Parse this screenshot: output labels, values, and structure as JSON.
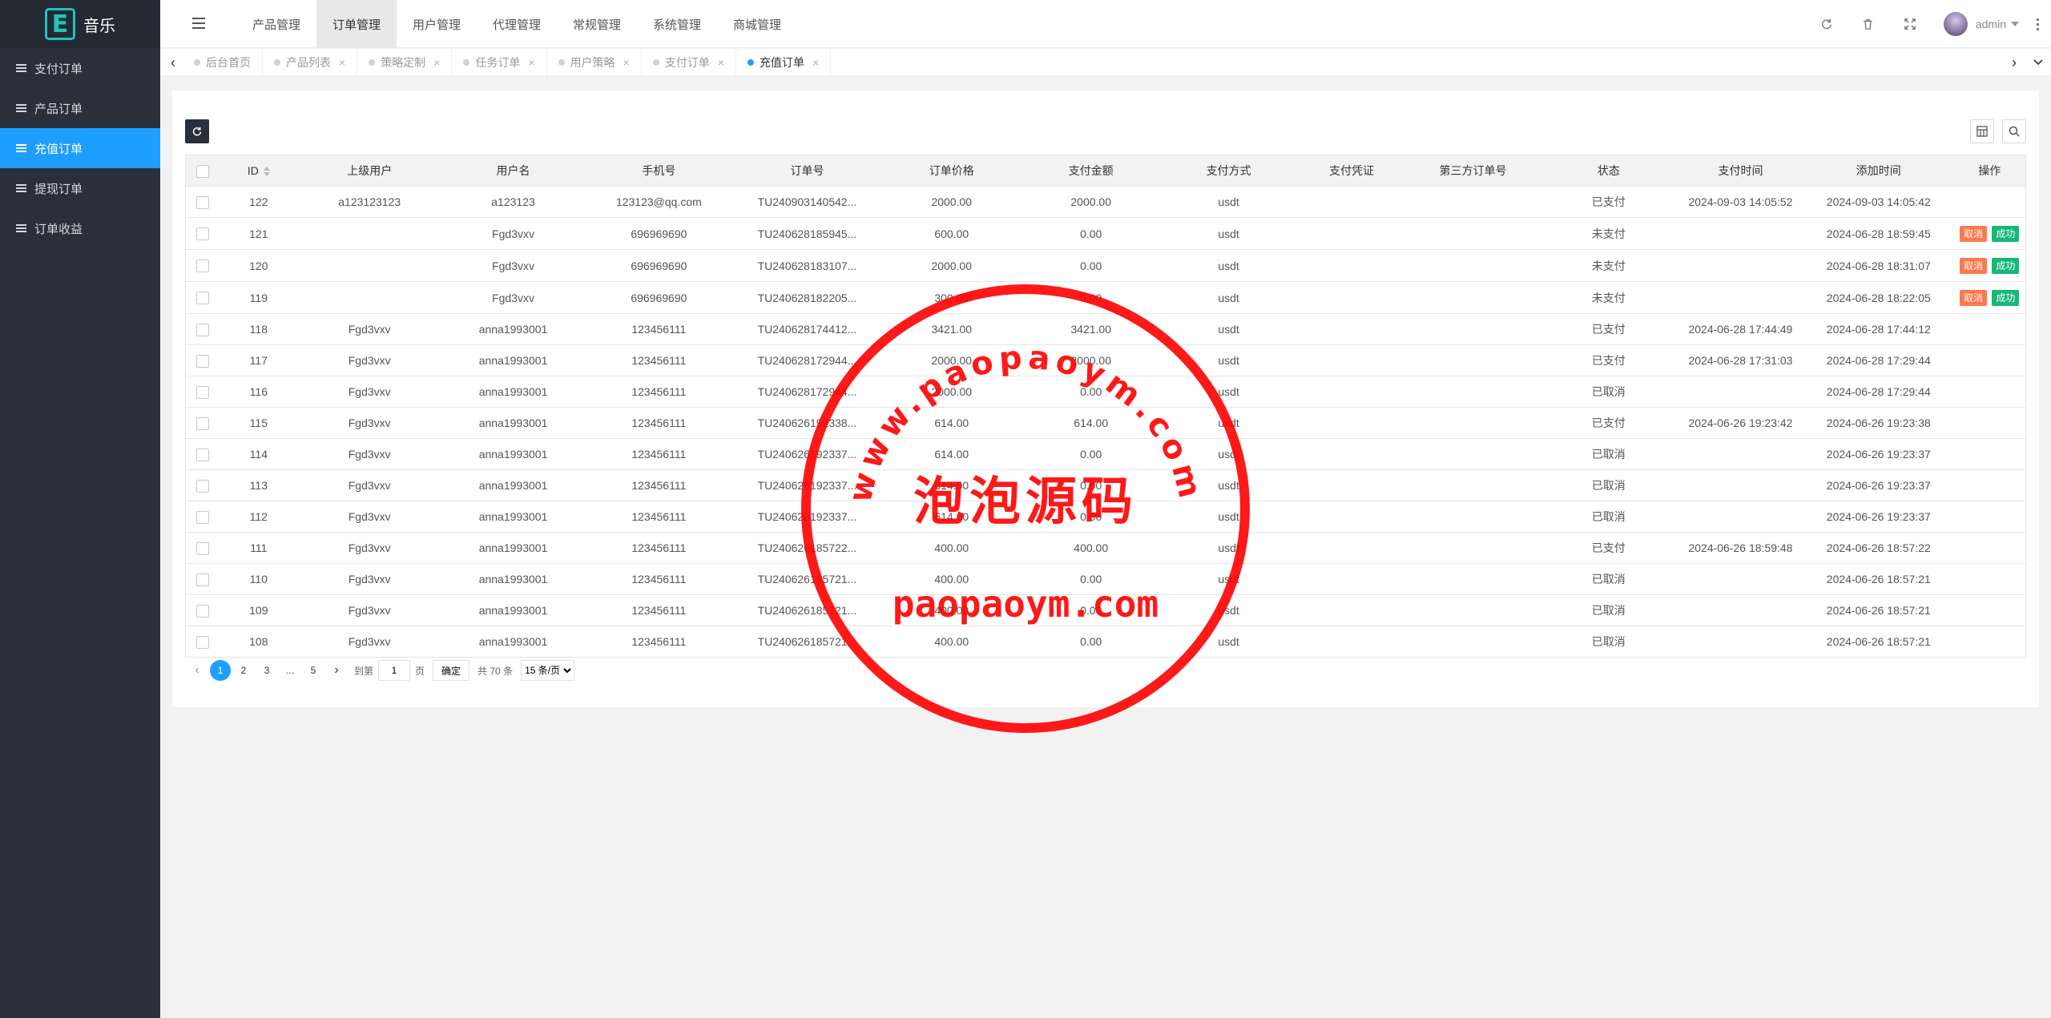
{
  "app": {
    "logo_letter": "E",
    "name": "音乐"
  },
  "sidebar": {
    "items": [
      {
        "label": "支付订单",
        "active": false
      },
      {
        "label": "产品订单",
        "active": false
      },
      {
        "label": "充值订单",
        "active": true
      },
      {
        "label": "提现订单",
        "active": false
      },
      {
        "label": "订单收益",
        "active": false
      }
    ]
  },
  "topnav": {
    "items": [
      {
        "label": "产品管理",
        "active": false
      },
      {
        "label": "订单管理",
        "active": true
      },
      {
        "label": "用户管理",
        "active": false
      },
      {
        "label": "代理管理",
        "active": false
      },
      {
        "label": "常规管理",
        "active": false
      },
      {
        "label": "系统管理",
        "active": false
      },
      {
        "label": "商城管理",
        "active": false
      }
    ]
  },
  "header": {
    "user_name": "admin"
  },
  "tabs": [
    {
      "label": "后台首页",
      "closable": false,
      "active": false
    },
    {
      "label": "产品列表",
      "closable": true,
      "active": false
    },
    {
      "label": "策略定制",
      "closable": true,
      "active": false
    },
    {
      "label": "任务订单",
      "closable": true,
      "active": false
    },
    {
      "label": "用户策略",
      "closable": true,
      "active": false
    },
    {
      "label": "支付订单",
      "closable": true,
      "active": false
    },
    {
      "label": "充值订单",
      "closable": true,
      "active": true
    }
  ],
  "table": {
    "columns": [
      "ID",
      "上级用户",
      "用户名",
      "手机号",
      "订单号",
      "订单价格",
      "支付金额",
      "支付方式",
      "支付凭证",
      "第三方订单号",
      "状态",
      "支付时间",
      "添加时间",
      "操作"
    ],
    "action_labels": {
      "cancel": "取消",
      "success": "成功"
    },
    "rows": [
      {
        "id": "122",
        "parent": "a123123123",
        "username": "a123123",
        "phone": "123123@qq.com",
        "order_no": "TU240903140542...",
        "price": "2000.00",
        "paid": "2000.00",
        "method": "usdt",
        "voucher": "",
        "third_no": "",
        "status": "已支付",
        "pay_time": "2024-09-03 14:05:52",
        "add_time": "2024-09-03 14:05:42",
        "actions": false
      },
      {
        "id": "121",
        "parent": "",
        "username": "Fgd3vxv",
        "phone": "696969690",
        "order_no": "TU240628185945...",
        "price": "600.00",
        "paid": "0.00",
        "method": "usdt",
        "voucher": "",
        "third_no": "",
        "status": "未支付",
        "pay_time": "",
        "add_time": "2024-06-28 18:59:45",
        "actions": true
      },
      {
        "id": "120",
        "parent": "",
        "username": "Fgd3vxv",
        "phone": "696969690",
        "order_no": "TU240628183107...",
        "price": "2000.00",
        "paid": "0.00",
        "method": "usdt",
        "voucher": "",
        "third_no": "",
        "status": "未支付",
        "pay_time": "",
        "add_time": "2024-06-28 18:31:07",
        "actions": true
      },
      {
        "id": "119",
        "parent": "",
        "username": "Fgd3vxv",
        "phone": "696969690",
        "order_no": "TU240628182205...",
        "price": "300.00",
        "paid": "0.00",
        "method": "usdt",
        "voucher": "",
        "third_no": "",
        "status": "未支付",
        "pay_time": "",
        "add_time": "2024-06-28 18:22:05",
        "actions": true
      },
      {
        "id": "118",
        "parent": "Fgd3vxv",
        "username": "anna1993001",
        "phone": "123456111",
        "order_no": "TU240628174412...",
        "price": "3421.00",
        "paid": "3421.00",
        "method": "usdt",
        "voucher": "",
        "third_no": "",
        "status": "已支付",
        "pay_time": "2024-06-28 17:44:49",
        "add_time": "2024-06-28 17:44:12",
        "actions": false
      },
      {
        "id": "117",
        "parent": "Fgd3vxv",
        "username": "anna1993001",
        "phone": "123456111",
        "order_no": "TU240628172944...",
        "price": "2000.00",
        "paid": "2000.00",
        "method": "usdt",
        "voucher": "",
        "third_no": "",
        "status": "已支付",
        "pay_time": "2024-06-28 17:31:03",
        "add_time": "2024-06-28 17:29:44",
        "actions": false
      },
      {
        "id": "116",
        "parent": "Fgd3vxv",
        "username": "anna1993001",
        "phone": "123456111",
        "order_no": "TU240628172944...",
        "price": "2000.00",
        "paid": "0.00",
        "method": "usdt",
        "voucher": "",
        "third_no": "",
        "status": "已取消",
        "pay_time": "",
        "add_time": "2024-06-28 17:29:44",
        "actions": false
      },
      {
        "id": "115",
        "parent": "Fgd3vxv",
        "username": "anna1993001",
        "phone": "123456111",
        "order_no": "TU240626192338...",
        "price": "614.00",
        "paid": "614.00",
        "method": "usdt",
        "voucher": "",
        "third_no": "",
        "status": "已支付",
        "pay_time": "2024-06-26 19:23:42",
        "add_time": "2024-06-26 19:23:38",
        "actions": false
      },
      {
        "id": "114",
        "parent": "Fgd3vxv",
        "username": "anna1993001",
        "phone": "123456111",
        "order_no": "TU240626192337...",
        "price": "614.00",
        "paid": "0.00",
        "method": "usdt",
        "voucher": "",
        "third_no": "",
        "status": "已取消",
        "pay_time": "",
        "add_time": "2024-06-26 19:23:37",
        "actions": false
      },
      {
        "id": "113",
        "parent": "Fgd3vxv",
        "username": "anna1993001",
        "phone": "123456111",
        "order_no": "TU240626192337...",
        "price": "614.00",
        "paid": "0.00",
        "method": "usdt",
        "voucher": "",
        "third_no": "",
        "status": "已取消",
        "pay_time": "",
        "add_time": "2024-06-26 19:23:37",
        "actions": false
      },
      {
        "id": "112",
        "parent": "Fgd3vxv",
        "username": "anna1993001",
        "phone": "123456111",
        "order_no": "TU240626192337...",
        "price": "614.00",
        "paid": "0.00",
        "method": "usdt",
        "voucher": "",
        "third_no": "",
        "status": "已取消",
        "pay_time": "",
        "add_time": "2024-06-26 19:23:37",
        "actions": false
      },
      {
        "id": "111",
        "parent": "Fgd3vxv",
        "username": "anna1993001",
        "phone": "123456111",
        "order_no": "TU240626185722...",
        "price": "400.00",
        "paid": "400.00",
        "method": "usdt",
        "voucher": "",
        "third_no": "",
        "status": "已支付",
        "pay_time": "2024-06-26 18:59:48",
        "add_time": "2024-06-26 18:57:22",
        "actions": false
      },
      {
        "id": "110",
        "parent": "Fgd3vxv",
        "username": "anna1993001",
        "phone": "123456111",
        "order_no": "TU240626185721...",
        "price": "400.00",
        "paid": "0.00",
        "method": "usdt",
        "voucher": "",
        "third_no": "",
        "status": "已取消",
        "pay_time": "",
        "add_time": "2024-06-26 18:57:21",
        "actions": false
      },
      {
        "id": "109",
        "parent": "Fgd3vxv",
        "username": "anna1993001",
        "phone": "123456111",
        "order_no": "TU240626185721...",
        "price": "400.00",
        "paid": "0.00",
        "method": "usdt",
        "voucher": "",
        "third_no": "",
        "status": "已取消",
        "pay_time": "",
        "add_time": "2024-06-26 18:57:21",
        "actions": false
      },
      {
        "id": "108",
        "parent": "Fgd3vxv",
        "username": "anna1993001",
        "phone": "123456111",
        "order_no": "TU240626185721...",
        "price": "400.00",
        "paid": "0.00",
        "method": "usdt",
        "voucher": "",
        "third_no": "",
        "status": "已取消",
        "pay_time": "",
        "add_time": "2024-06-26 18:57:21",
        "actions": false
      }
    ]
  },
  "pagination": {
    "pages": [
      "1",
      "2",
      "3"
    ],
    "ellipsis": "…",
    "last_page": "5",
    "current": "1",
    "skip_prefix": "到第",
    "skip_value": "1",
    "skip_suffix": "页",
    "skip_button": "确定",
    "total_text": "共 70 条",
    "limit_option": "15 条/页"
  },
  "watermark": {
    "ring_text": "www.paopaoym.com",
    "center_text": "泡泡源码",
    "bottom_text": "paopaoym.com",
    "color": "#ff0000"
  },
  "colors": {
    "sidebar_bg": "#2a303b",
    "accent": "#1e9fff",
    "cancel": "#ff5722",
    "success": "#16b777"
  }
}
